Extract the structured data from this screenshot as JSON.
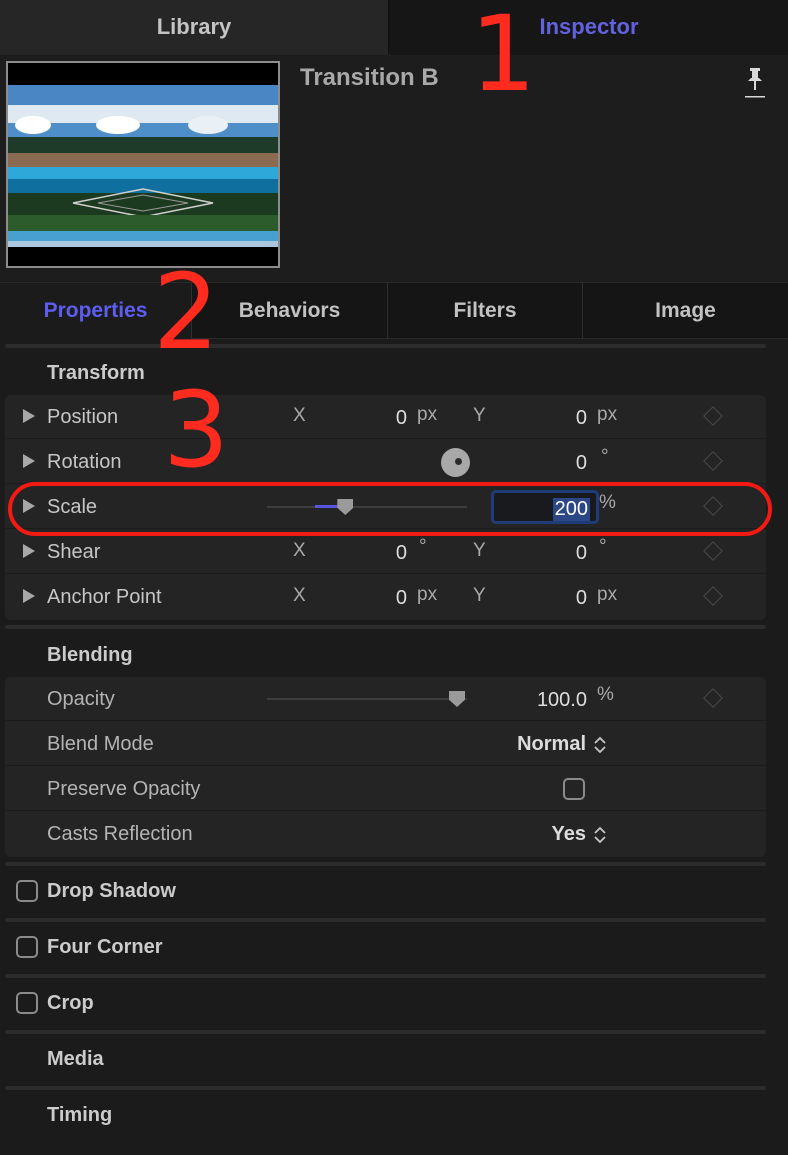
{
  "top_tabs": {
    "library": "Library",
    "inspector": "Inspector"
  },
  "preview": {
    "title": "Transition B"
  },
  "sub_tabs": {
    "properties": "Properties",
    "behaviors": "Behaviors",
    "filters": "Filters",
    "image": "Image"
  },
  "transform": {
    "title": "Transform",
    "position": {
      "label": "Position",
      "x_axis": "X",
      "x_value": "0",
      "x_unit": "px",
      "y_axis": "Y",
      "y_value": "0",
      "y_unit": "px"
    },
    "rotation": {
      "label": "Rotation",
      "value": "0",
      "unit": "°"
    },
    "scale": {
      "label": "Scale",
      "value": "200",
      "unit": "%",
      "slider_fraction": 0.4
    },
    "shear": {
      "label": "Shear",
      "x_axis": "X",
      "x_value": "0",
      "x_unit": "°",
      "y_axis": "Y",
      "y_value": "0",
      "y_unit": "°"
    },
    "anchor": {
      "label": "Anchor Point",
      "x_axis": "X",
      "x_value": "0",
      "x_unit": "px",
      "y_axis": "Y",
      "y_value": "0",
      "y_unit": "px"
    }
  },
  "blending": {
    "title": "Blending",
    "opacity": {
      "label": "Opacity",
      "value": "100.0",
      "unit": "%",
      "slider_fraction": 1.0
    },
    "blend_mode": {
      "label": "Blend Mode",
      "value": "Normal"
    },
    "preserve_opacity": {
      "label": "Preserve Opacity",
      "checked": false
    },
    "casts_reflection": {
      "label": "Casts Reflection",
      "value": "Yes"
    }
  },
  "sections": {
    "drop_shadow": "Drop Shadow",
    "four_corner": "Four Corner",
    "crop": "Crop",
    "media": "Media",
    "timing": "Timing"
  },
  "annotations": {
    "one": "1",
    "two": "2",
    "three": "3"
  },
  "colors": {
    "accent": "#5d5df0",
    "annotation": "#f21a12",
    "field_focus": "#1f3c78"
  }
}
